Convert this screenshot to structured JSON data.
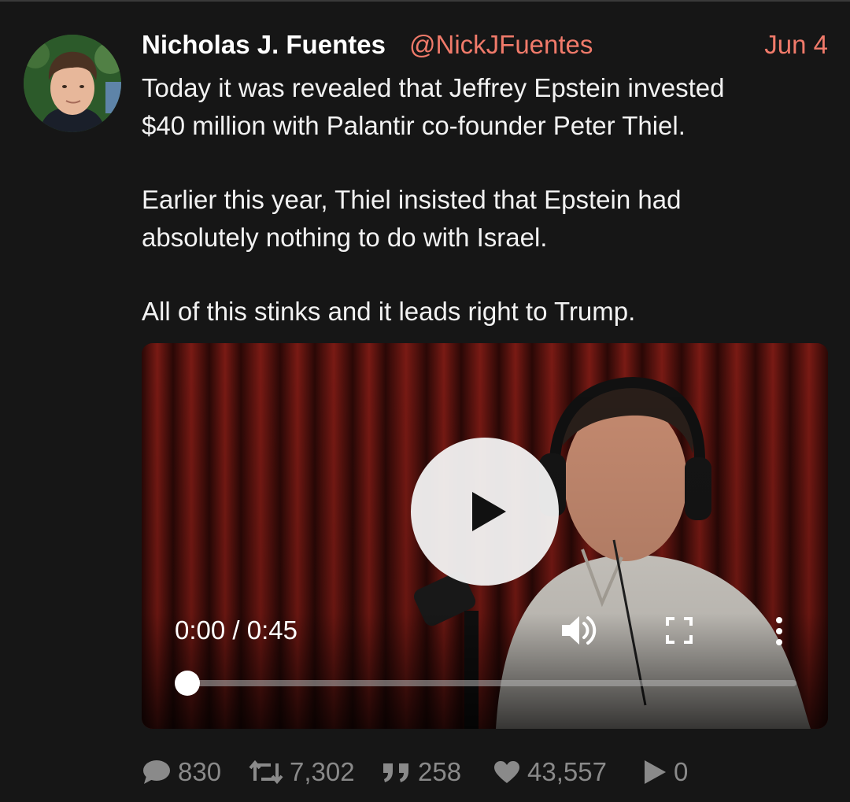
{
  "tweet": {
    "author": {
      "display_name": "Nicholas J. Fuentes",
      "handle": "@NickJFuentes",
      "avatar_icon": "profile-photo"
    },
    "date": "Jun 4",
    "text": {
      "line1": "Today it was revealed that Jeffrey Epstein invested",
      "line2": "$40 million with Palantir co-founder Peter Thiel.",
      "line3": "Earlier this year, Thiel insisted that Epstein had",
      "line4": "absolutely nothing to do with Israel.",
      "line5": "All of this stinks and it leads right to Trump."
    },
    "video": {
      "time": "0:00 / 0:45",
      "progress_fraction": 0.0,
      "icons": {
        "play": "play-icon",
        "volume": "volume-icon",
        "fullscreen": "fullscreen-icon",
        "more": "more-vertical-icon"
      }
    },
    "stats": {
      "replies": "830",
      "retweets": "7,302",
      "quotes": "258",
      "likes": "43,557",
      "plays": "0"
    }
  },
  "colors": {
    "background": "#161616",
    "accent": "#f07a6a",
    "text": "#f2f2f2",
    "muted": "#8a8a8a"
  }
}
